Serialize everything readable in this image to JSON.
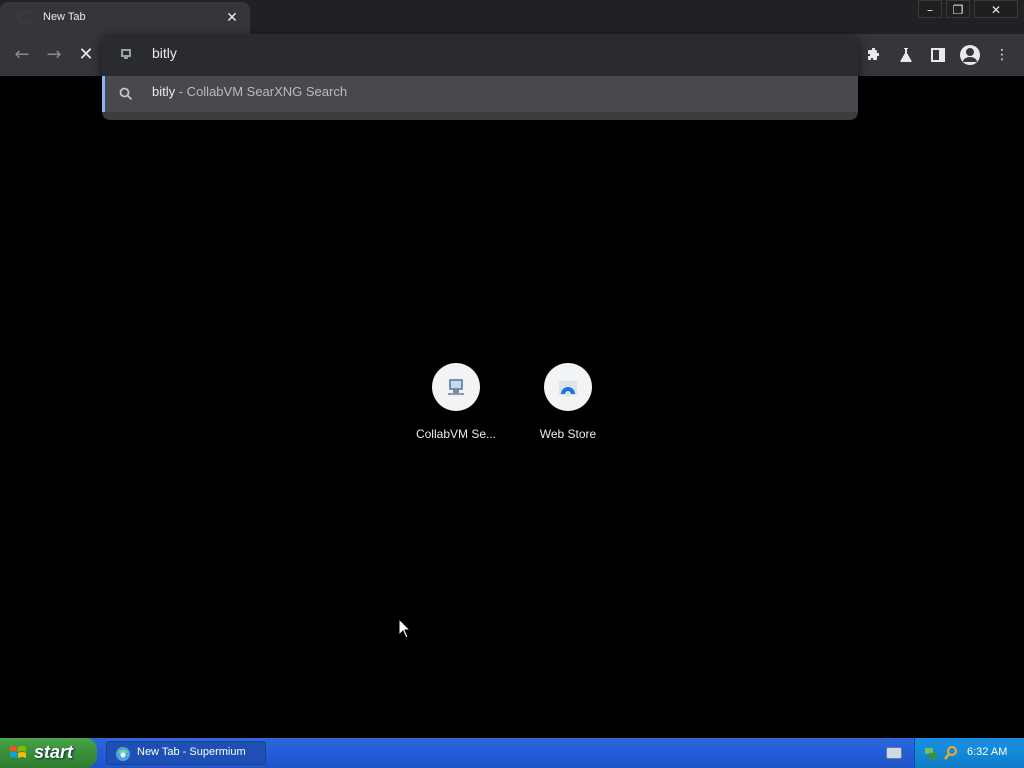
{
  "browser": {
    "tab": {
      "title": "New Tab"
    },
    "omnibox": {
      "value": "bitly",
      "suggestion": {
        "query": "bitly",
        "engine_text": " - CollabVM SearXNG Search"
      }
    },
    "toolbar": {
      "icons": [
        "back-icon",
        "forward-icon",
        "stop-icon",
        "extensions-icon",
        "labs-icon",
        "side-panel-icon",
        "profile-icon",
        "menu-icon"
      ]
    }
  },
  "new_tab": {
    "shortcuts": [
      {
        "label": "CollabVM Se..."
      },
      {
        "label": "Web Store"
      }
    ]
  },
  "taskbar": {
    "start_label": "start",
    "tasks": [
      {
        "label": "New Tab - Supermium"
      }
    ],
    "clock": "6:32 AM"
  },
  "colors": {
    "tab_strip_bg": "#202124",
    "toolbar_bg": "#35363a",
    "omnibox_suggest_bg": "#48494c",
    "omnibox_accent": "#8ab4f8",
    "taskbar_blue": "#245edb",
    "start_green": "#3a8f3a"
  }
}
